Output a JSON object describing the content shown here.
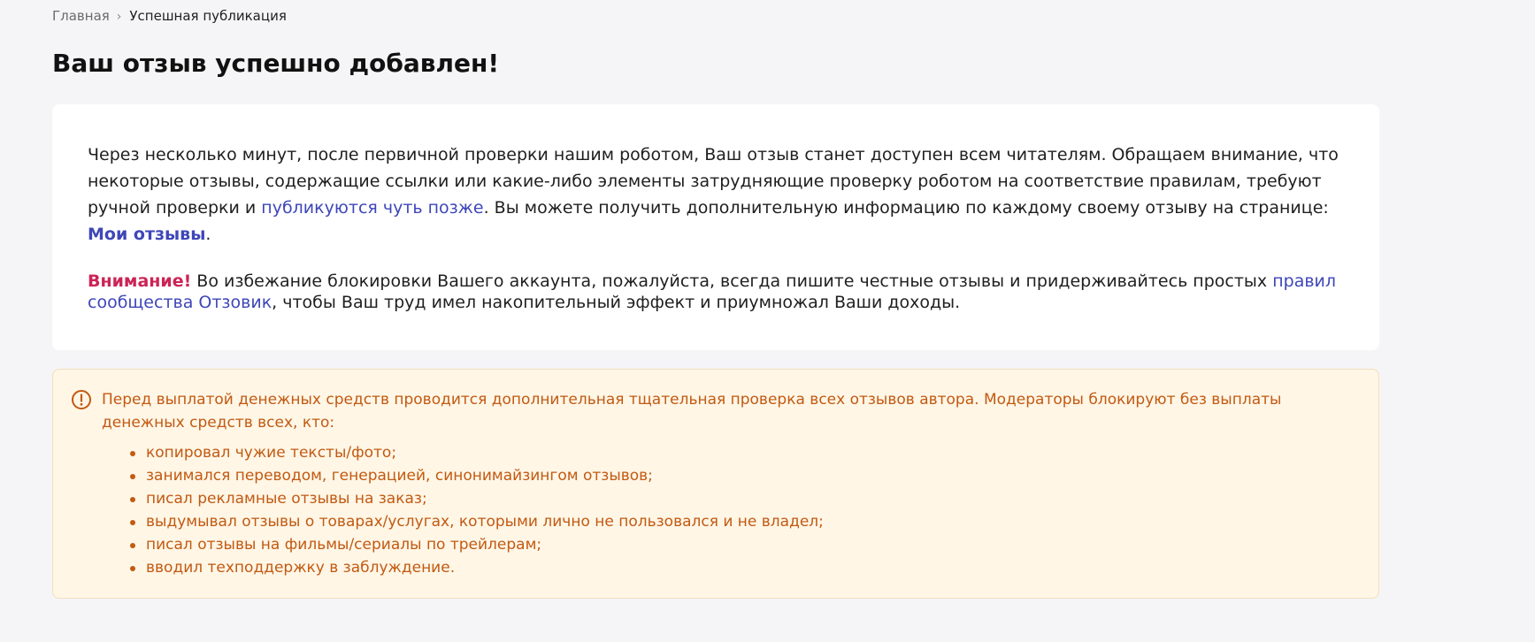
{
  "breadcrumb": {
    "home": "Главная",
    "separator": "›",
    "current": "Успешная публикация"
  },
  "title": "Ваш отзыв успешно добавлен!",
  "info": {
    "text_before_link": "Через несколько минут, после первичной проверки нашим роботом, Ваш отзыв станет доступен всем читателям. Обращаем внимание, что некоторые отзывы, содержащие ссылки или какие-либо элементы затрудняющие проверку роботом на соответствие правилам, требуют ручной проверки и ",
    "later_link": "публикуются чуть позже",
    "text_after_link": ". Вы можете получить дополнительную информацию по каждому своему отзыву на странице: ",
    "my_reviews_link": "Мои отзывы",
    "period": "."
  },
  "warning": {
    "label": "Внимание!",
    "text_before_link": " Во избежание блокировки Вашего аккаунта, пожалуйста, всегда пишите честные отзывы и придерживайтесь простых ",
    "rules_link": "правил сообщества Отзовик",
    "text_after_link": ", чтобы Ваш труд имел накопительный эффект и приумножал Ваши доходы."
  },
  "notice": {
    "icon": "exclamation-circle-icon",
    "intro": "Перед выплатой денежных средств проводится дополнительная тщательная проверка всех отзывов автора. Модераторы блокируют без выплаты денежных средств всех, кто:",
    "items": [
      "копировал чужие тексты/фото;",
      "занимался переводом, генерацией, синонимайзингом отзывов;",
      "писал рекламные отзывы на заказ;",
      "выдумывал отзывы о товарах/услугах, которыми лично не пользовался и не владел;",
      "писал отзывы на фильмы/сериалы по трейлерам;",
      "вводил техподдержку в заблуждение."
    ]
  },
  "colors": {
    "page_background": "#f5f5f7",
    "card_background": "#ffffff",
    "link": "#3e46b8",
    "attention": "#cc2357",
    "notice_background": "#fff6e6",
    "notice_text": "#c25a12"
  }
}
